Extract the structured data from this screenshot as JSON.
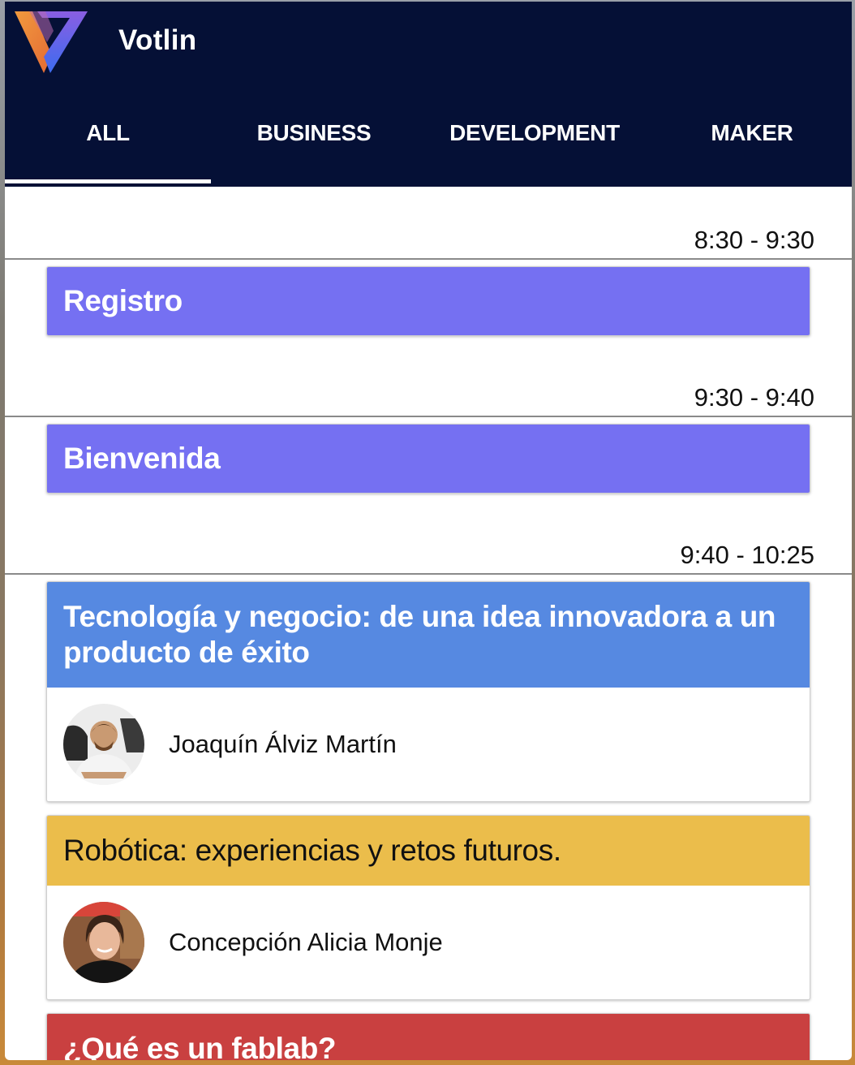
{
  "app": {
    "title": "Votlin"
  },
  "tabs": [
    {
      "label": "ALL",
      "selected": true
    },
    {
      "label": "BUSINESS",
      "selected": false
    },
    {
      "label": "DEVELOPMENT",
      "selected": false
    },
    {
      "label": "MAKER",
      "selected": false
    }
  ],
  "schedule": [
    {
      "time": "8:30 - 9:30",
      "talks": [
        {
          "title": "Registro",
          "color": "#7570f2"
        }
      ]
    },
    {
      "time": "9:30 - 9:40",
      "talks": [
        {
          "title": "Bienvenida",
          "color": "#7570f2"
        }
      ]
    },
    {
      "time": "9:40 - 10:25",
      "talks": [
        {
          "title": "Tecnología y negocio: de una idea innovadora a un producto de éxito",
          "color": "#5689e1",
          "speaker": "Joaquín Álviz Martín"
        },
        {
          "title": "Robótica: experiencias y retos futuros.",
          "color": "#ebbd4b",
          "speaker": "Concepción Alicia Monje"
        },
        {
          "title": "¿Qué es un fablab?",
          "color": "#c94040"
        }
      ]
    }
  ],
  "colors": {
    "appbar": "#051036",
    "tab_indicator": "#ffffff",
    "logo_orange": "#ef8a3c",
    "logo_blue": "#4a63e8",
    "logo_purple": "#8c5ce0"
  }
}
